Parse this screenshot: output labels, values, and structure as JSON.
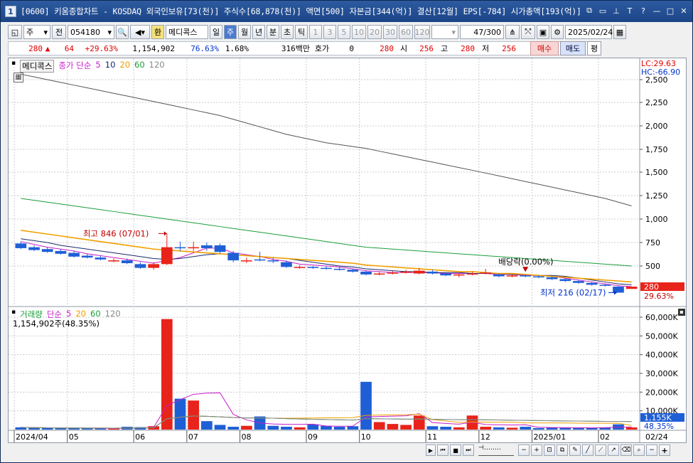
{
  "window": {
    "number": "1",
    "title": "[0600] 키움종합차트 - KOSDAQ 외국인보유[73(천)] 주식수[68,878(천)] 액면[500] 자본금[344(억)] 결산[12월] EPS[-784] 시가총액[193(억)]"
  },
  "toolbar": {
    "market": "주",
    "prev": "전",
    "code": "054180",
    "currency": "환",
    "stock_name": "메디콕스",
    "periods": [
      "일",
      "주",
      "월",
      "년",
      "분",
      "초",
      "틱"
    ],
    "active_period": "주",
    "intervals": [
      "1",
      "3",
      "5",
      "10",
      "20",
      "30",
      "60",
      "120"
    ],
    "count": "47",
    "count_total": "/300",
    "date": "2025/02/24"
  },
  "quote": {
    "price": "280",
    "change": "64",
    "change_pct": "+29.63%",
    "volume": "1,154,902",
    "vol_ratio": "76.63%",
    "turnover": "1.68%",
    "amount": "316백만",
    "hoga_label": "호가",
    "hoga_value": "0",
    "hoga_price": "280",
    "open_label": "시",
    "open": "256",
    "high_label": "고",
    "high": "280",
    "low_label": "저",
    "low": "256",
    "buy": "매수",
    "sell": "매도",
    "avg": "평"
  },
  "price_panel": {
    "name": "메디콕스",
    "ma_label": "종가 단순",
    "ma_periods": [
      "5",
      "10",
      "20",
      "60",
      "120"
    ],
    "lc": "LC:29.63",
    "hc": "HC:-66.90",
    "y_ticks": [
      "2,500",
      "2,250",
      "2,000",
      "1,750",
      "1,500",
      "1,250",
      "1,000",
      "750",
      "500"
    ],
    "last_price": "280",
    "last_pct": "29.63%",
    "annot_high": "최고 846 (07/01)",
    "annot_div": "배당락(0.00%)",
    "annot_low": "최저 216 (02/17)"
  },
  "volume_panel": {
    "label": "거래량",
    "ma_label": "단순",
    "ma_periods": [
      "5",
      "20",
      "60",
      "120"
    ],
    "current": "1,154,902주(48.35%)",
    "y_ticks": [
      "60,000K",
      "50,000K",
      "40,000K",
      "30,000K",
      "20,000K",
      "10,000K"
    ],
    "last_vol": "1,155K",
    "last_pct": "48.35%"
  },
  "x_axis": {
    "labels": [
      "2024/04",
      "05",
      "06",
      "07",
      "08",
      "09",
      "10",
      "11",
      "12",
      "2025/01",
      "02"
    ],
    "right_label": "02/24"
  },
  "colors": {
    "up": "#e8231a",
    "down": "#1f5fd6",
    "ma5": "#c81ec8",
    "ma10": "#1b2a6b",
    "ma20": "#f0a000",
    "ma60": "#1a9e3a",
    "ma120": "#555555"
  },
  "chart_data": {
    "type": "candlestick",
    "title": "메디콕스",
    "x": [
      "2024/04",
      "05",
      "06",
      "07",
      "08",
      "09",
      "10",
      "11",
      "12",
      "2025/01",
      "02",
      "02/24"
    ],
    "price_ylim": [
      0,
      2500
    ],
    "volume_ylim": [
      0,
      60000
    ],
    "candles": [
      {
        "o": 740,
        "c": 690,
        "h": 760,
        "l": 680
      },
      {
        "o": 700,
        "c": 670,
        "h": 720,
        "l": 660
      },
      {
        "o": 680,
        "c": 650,
        "h": 700,
        "l": 640
      },
      {
        "o": 660,
        "c": 630,
        "h": 680,
        "l": 620
      },
      {
        "o": 640,
        "c": 600,
        "h": 660,
        "l": 590
      },
      {
        "o": 610,
        "c": 590,
        "h": 630,
        "l": 580
      },
      {
        "o": 590,
        "c": 570,
        "h": 610,
        "l": 560
      },
      {
        "o": 560,
        "c": 560,
        "h": 580,
        "l": 540
      },
      {
        "o": 560,
        "c": 530,
        "h": 580,
        "l": 520
      },
      {
        "o": 520,
        "c": 480,
        "h": 540,
        "l": 470
      },
      {
        "o": 480,
        "c": 520,
        "h": 540,
        "l": 460
      },
      {
        "o": 520,
        "c": 700,
        "h": 846,
        "l": 510
      },
      {
        "o": 700,
        "c": 690,
        "h": 760,
        "l": 660
      },
      {
        "o": 690,
        "c": 700,
        "h": 760,
        "l": 660
      },
      {
        "o": 720,
        "c": 690,
        "h": 750,
        "l": 660
      },
      {
        "o": 720,
        "c": 650,
        "h": 740,
        "l": 630
      },
      {
        "o": 640,
        "c": 560,
        "h": 660,
        "l": 540
      },
      {
        "o": 560,
        "c": 560,
        "h": 590,
        "l": 530
      },
      {
        "o": 570,
        "c": 560,
        "h": 650,
        "l": 550
      },
      {
        "o": 560,
        "c": 550,
        "h": 590,
        "l": 530
      },
      {
        "o": 540,
        "c": 490,
        "h": 560,
        "l": 480
      },
      {
        "o": 490,
        "c": 490,
        "h": 510,
        "l": 470
      },
      {
        "o": 490,
        "c": 480,
        "h": 500,
        "l": 470
      },
      {
        "o": 480,
        "c": 470,
        "h": 500,
        "l": 460
      },
      {
        "o": 470,
        "c": 460,
        "h": 490,
        "l": 450
      },
      {
        "o": 460,
        "c": 440,
        "h": 470,
        "l": 430
      },
      {
        "o": 440,
        "c": 410,
        "h": 450,
        "l": 400
      },
      {
        "o": 410,
        "c": 420,
        "h": 440,
        "l": 400
      },
      {
        "o": 420,
        "c": 430,
        "h": 450,
        "l": 410
      },
      {
        "o": 430,
        "c": 440,
        "h": 460,
        "l": 420
      },
      {
        "o": 420,
        "c": 450,
        "h": 480,
        "l": 410
      },
      {
        "o": 440,
        "c": 420,
        "h": 460,
        "l": 410
      },
      {
        "o": 420,
        "c": 400,
        "h": 430,
        "l": 390
      },
      {
        "o": 400,
        "c": 410,
        "h": 420,
        "l": 380
      },
      {
        "o": 410,
        "c": 420,
        "h": 440,
        "l": 400
      },
      {
        "o": 420,
        "c": 430,
        "h": 470,
        "l": 410
      },
      {
        "o": 410,
        "c": 390,
        "h": 420,
        "l": 380
      },
      {
        "o": 390,
        "c": 400,
        "h": 410,
        "l": 380
      },
      {
        "o": 400,
        "c": 390,
        "h": 410,
        "l": 380
      },
      {
        "o": 390,
        "c": 380,
        "h": 400,
        "l": 370
      },
      {
        "o": 380,
        "c": 360,
        "h": 390,
        "l": 350
      },
      {
        "o": 360,
        "c": 340,
        "h": 370,
        "l": 330
      },
      {
        "o": 340,
        "c": 320,
        "h": 350,
        "l": 310
      },
      {
        "o": 320,
        "c": 300,
        "h": 330,
        "l": 290
      },
      {
        "o": 300,
        "c": 290,
        "h": 310,
        "l": 280
      },
      {
        "o": 280,
        "c": 216,
        "h": 290,
        "l": 216
      },
      {
        "o": 256,
        "c": 280,
        "h": 280,
        "l": 256
      }
    ],
    "volume": [
      1200,
      900,
      800,
      700,
      600,
      700,
      600,
      500,
      1500,
      1300,
      1800,
      59000,
      16500,
      15500,
      4500,
      2500,
      1500,
      2000,
      7000,
      2000,
      1500,
      1200,
      2800,
      2000,
      1500,
      1800,
      25500,
      4000,
      3000,
      2500,
      7500,
      1800,
      1500,
      1200,
      7500,
      1500,
      1200,
      1000,
      1500,
      800,
      1000,
      900,
      800,
      1000,
      1200,
      2800,
      1155
    ],
    "series": [
      {
        "name": "5",
        "values": [
          760,
          730,
          700,
          680,
          660,
          630,
          610,
          590,
          570,
          550,
          530,
          560,
          590,
          640,
          690,
          690,
          640,
          620,
          600,
          570,
          550,
          520,
          510,
          500,
          490,
          470,
          450,
          440,
          430,
          430,
          430,
          430,
          420,
          420,
          420,
          420,
          410,
          410,
          400,
          400,
          390,
          370,
          350,
          330,
          310,
          290,
          280
        ]
      },
      {
        "name": "10",
        "values": [
          790,
          770,
          750,
          720,
          700,
          680,
          660,
          640,
          620,
          600,
          580,
          570,
          580,
          600,
          620,
          630,
          620,
          610,
          600,
          590,
          580,
          560,
          540,
          520,
          500,
          490,
          470,
          460,
          450,
          440,
          440,
          430,
          430,
          430,
          420,
          420,
          420,
          410,
          410,
          400,
          400,
          390,
          370,
          350,
          330,
          310,
          300
        ]
      },
      {
        "name": "20",
        "values": [
          880,
          860,
          840,
          820,
          800,
          780,
          760,
          740,
          720,
          700,
          680,
          670,
          660,
          650,
          640,
          630,
          620,
          610,
          600,
          590,
          580,
          570,
          560,
          550,
          540,
          530,
          510,
          500,
          490,
          480,
          470,
          460,
          450,
          440,
          440,
          430,
          420,
          420,
          410,
          400,
          390,
          380,
          370,
          360,
          350,
          340,
          330
        ]
      },
      {
        "name": "60",
        "values": [
          1220,
          1200,
          1180,
          1160,
          1140,
          1120,
          1100,
          1080,
          1060,
          1040,
          1020,
          1000,
          980,
          960,
          940,
          920,
          900,
          880,
          860,
          840,
          820,
          800,
          780,
          760,
          740,
          720,
          700,
          690,
          680,
          670,
          660,
          650,
          640,
          630,
          620,
          610,
          600,
          590,
          580,
          570,
          560,
          550,
          540,
          530,
          520,
          510,
          500
        ]
      },
      {
        "name": "120",
        "values": [
          2560,
          2530,
          2500,
          2470,
          2440,
          2410,
          2380,
          2350,
          2320,
          2290,
          2260,
          2230,
          2200,
          2170,
          2140,
          2110,
          2070,
          2030,
          1990,
          1950,
          1910,
          1880,
          1850,
          1820,
          1800,
          1780,
          1760,
          1730,
          1700,
          1670,
          1640,
          1610,
          1580,
          1550,
          1520,
          1490,
          1460,
          1430,
          1400,
          1370,
          1340,
          1310,
          1280,
          1250,
          1220,
          1180,
          1140
        ]
      }
    ]
  }
}
